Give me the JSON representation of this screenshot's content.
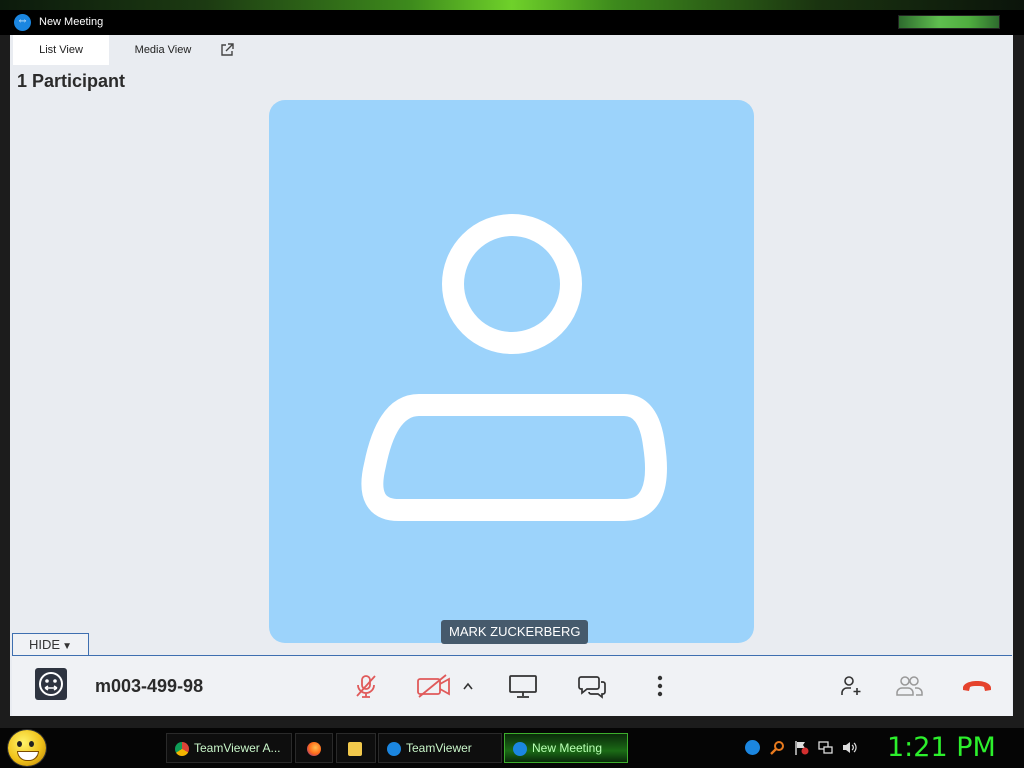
{
  "window": {
    "title": "New Meeting"
  },
  "tabs": [
    {
      "label": "List View"
    },
    {
      "label": "Media View"
    }
  ],
  "participants": {
    "count_label": "1 Participant"
  },
  "tile": {
    "name": "MARK ZUCKERBERG",
    "background": "#9cd3fb"
  },
  "panel": {
    "hide_label": "HIDE"
  },
  "controls": {
    "meeting_id": "m003-499-98",
    "end_call_color": "#e5432d",
    "muted_color": "#e05a5a"
  },
  "taskbar": {
    "items": [
      {
        "label": "TeamViewer A..."
      },
      {
        "label": "TeamViewer"
      },
      {
        "label": "New Meeting"
      }
    ],
    "clock": "1:21 PM"
  }
}
